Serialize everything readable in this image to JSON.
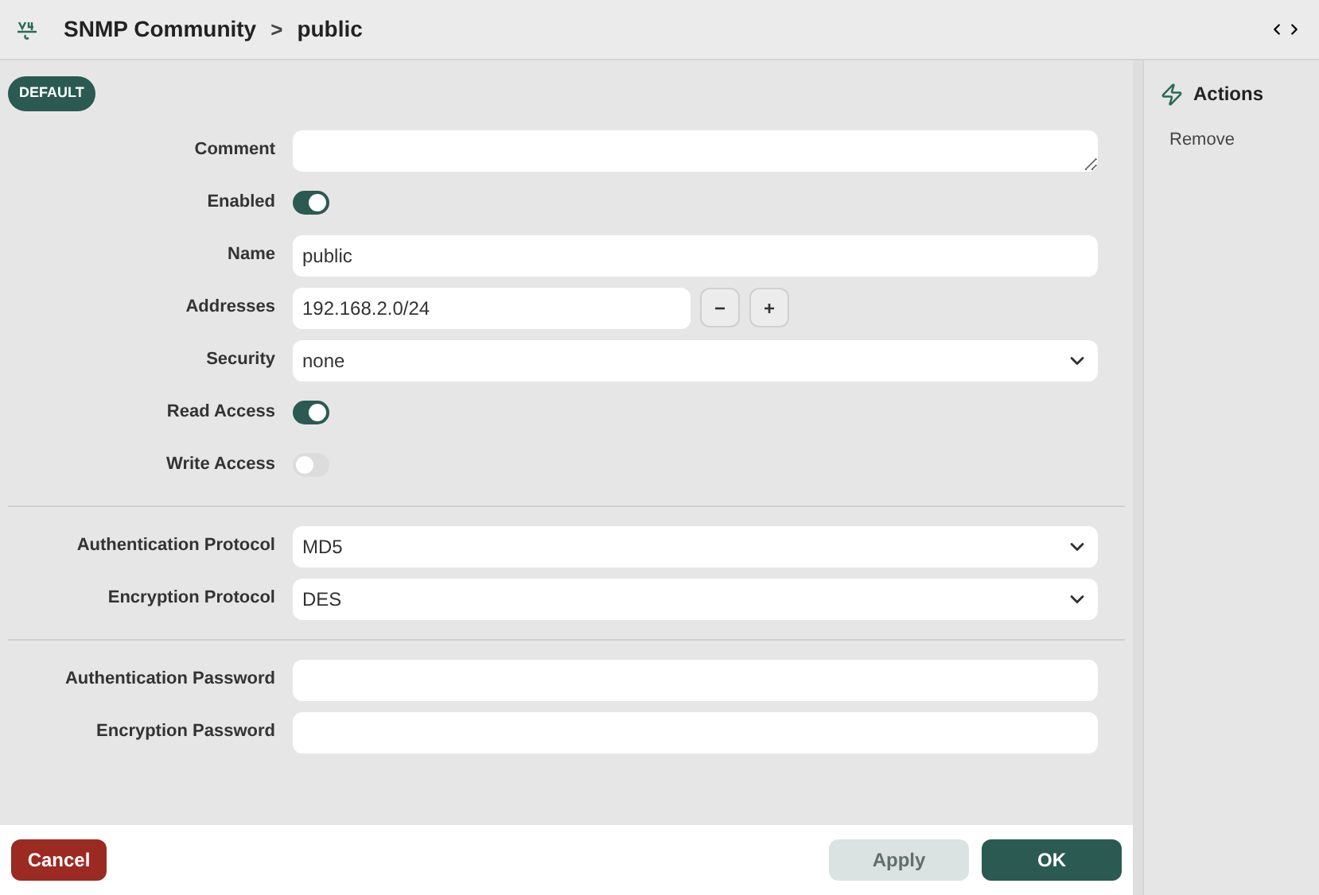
{
  "header": {
    "breadcrumb": [
      "SNMP Community",
      "public"
    ],
    "separator": ">"
  },
  "badge": "DEFAULT",
  "sections": [
    {
      "fields": [
        {
          "kind": "textarea",
          "label": "Comment"
        },
        {
          "kind": "toggle",
          "label": "Enabled",
          "on": true
        },
        {
          "kind": "text",
          "label": "Name",
          "value": "public"
        },
        {
          "kind": "address",
          "label": "Addresses",
          "value": "192.168.2.0/24",
          "buttons": [
            "−",
            "+"
          ]
        },
        {
          "kind": "select",
          "label": "Security",
          "value": "none"
        },
        {
          "kind": "toggle",
          "label": "Read Access",
          "on": true
        },
        {
          "kind": "toggle",
          "label": "Write Access",
          "on": false
        }
      ]
    },
    {
      "fields": [
        {
          "kind": "select",
          "label": "Authentication Protocol",
          "value": "MD5"
        },
        {
          "kind": "select",
          "label": "Encryption Protocol",
          "value": "DES"
        }
      ]
    },
    {
      "fields": [
        {
          "kind": "text",
          "label": "Authentication Password"
        },
        {
          "kind": "text",
          "label": "Encryption Password"
        }
      ]
    }
  ],
  "actions": {
    "title": "Actions",
    "items": [
      "Remove"
    ]
  },
  "footer": [
    {
      "kind": "danger",
      "label": "Cancel",
      "disabled": false
    },
    {
      "kind": "secondary",
      "label": "Apply",
      "disabled": true
    },
    {
      "kind": "primary",
      "label": "OK",
      "disabled": false
    }
  ]
}
